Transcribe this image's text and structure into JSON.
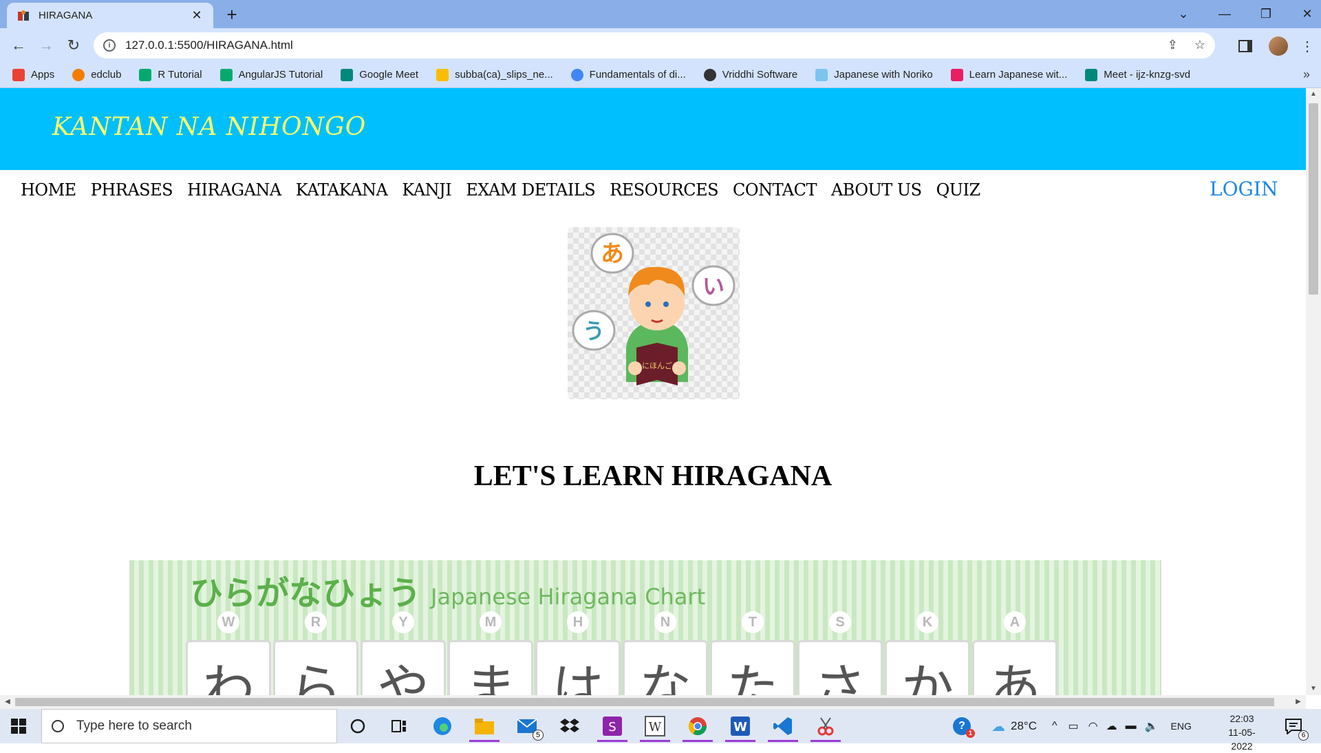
{
  "browser": {
    "tab_title": "HIRAGANA",
    "url": "127.0.0.1:5500/HIRAGANA.html",
    "bookmarks": [
      {
        "label": "Apps",
        "icon": "apps-grid-icon",
        "color": "#ea4335"
      },
      {
        "label": "edclub",
        "icon": "edclub-icon",
        "color": "#f57c00"
      },
      {
        "label": "R Tutorial",
        "icon": "w3schools-icon",
        "color": "#04aa6d"
      },
      {
        "label": "AngularJS Tutorial",
        "icon": "w3schools-icon",
        "color": "#04aa6d"
      },
      {
        "label": "Google Meet",
        "icon": "google-meet-icon",
        "color": "#00897b"
      },
      {
        "label": "subba(ca)_slips_ne...",
        "icon": "google-drive-icon",
        "color": "#fbbc04"
      },
      {
        "label": "Fundamentals of di...",
        "icon": "google-icon",
        "color": "#4285f4"
      },
      {
        "label": "Vriddhi Software",
        "icon": "globe-icon",
        "color": "#333333"
      },
      {
        "label": "Japanese with Noriko",
        "icon": "noriko-icon",
        "color": "#7cc4f0"
      },
      {
        "label": "Learn Japanese wit...",
        "icon": "learn-japanese-icon",
        "color": "#e91e63"
      },
      {
        "label": "Meet - ijz-knzg-svd",
        "icon": "google-meet-icon",
        "color": "#00897b"
      }
    ]
  },
  "site": {
    "logo": "KANTAN NA NIHONGO",
    "nav": [
      "HOME",
      "PHRASES",
      "HIRAGANA",
      "KATAKANA",
      "KANJI",
      "EXAM DETAILS",
      "RESOURCES",
      "CONTACT",
      "ABOUT US",
      "QUIZ"
    ],
    "login": "LOGIN",
    "hero_bubbles": [
      "あ",
      "い",
      "う"
    ],
    "book_text": "にほんご",
    "heading": "LET'S LEARN HIRAGANA",
    "chart": {
      "title_jp": "ひらがなひょう",
      "title_en": "Japanese Hiragana Chart",
      "columns": [
        {
          "romaji": "W",
          "kana": "わ"
        },
        {
          "romaji": "R",
          "kana": "ら"
        },
        {
          "romaji": "Y",
          "kana": "や"
        },
        {
          "romaji": "M",
          "kana": "ま"
        },
        {
          "romaji": "H",
          "kana": "は"
        },
        {
          "romaji": "N",
          "kana": "な"
        },
        {
          "romaji": "T",
          "kana": "た"
        },
        {
          "romaji": "S",
          "kana": "さ"
        },
        {
          "romaji": "K",
          "kana": "か"
        },
        {
          "romaji": "A",
          "kana": "あ"
        }
      ]
    }
  },
  "taskbar": {
    "search_placeholder": "Type here to search",
    "mail_badge": "5",
    "help_badge": "1",
    "weather": "28°C",
    "language": "ENG",
    "time": "22:03",
    "date": "11-05-2022",
    "notification_count": "6"
  },
  "colors": {
    "header_bg": "#00bfff",
    "logo": "#ffff66",
    "login": "#1e88e5",
    "chart_green": "#5bb04a"
  }
}
